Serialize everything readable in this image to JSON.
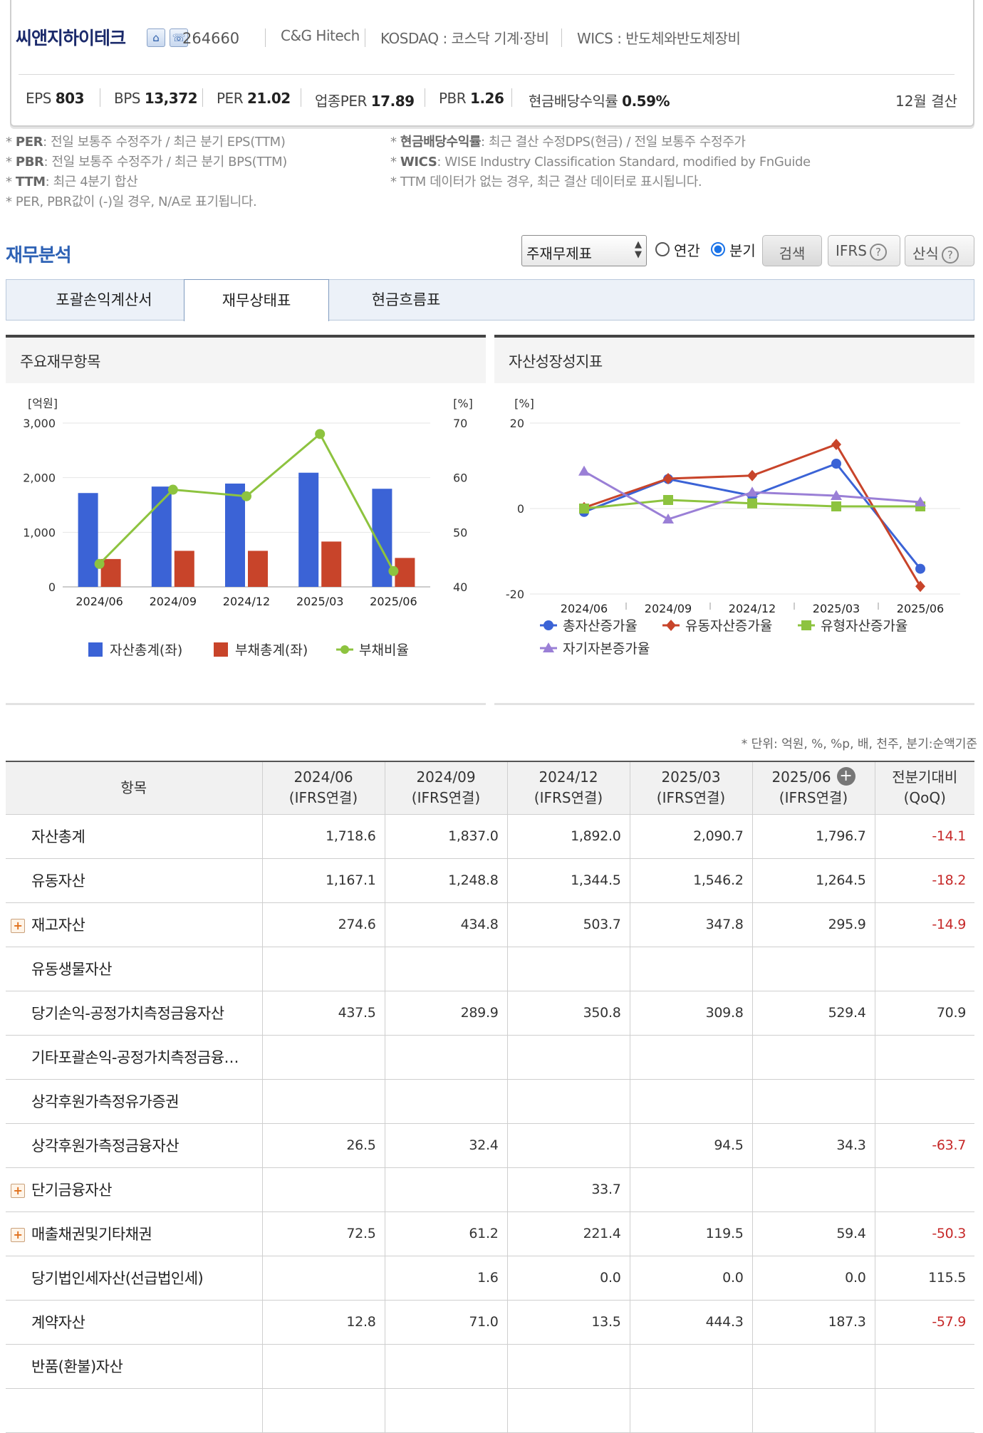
{
  "company": {
    "name": "씨앤지하이테크",
    "code": "264660",
    "english_name": "C&G Hitech",
    "market": "KOSDAQ : 코스닥 기계·장비",
    "wics": "WICS : 반도체와반도체장비"
  },
  "metrics": [
    {
      "label": "EPS",
      "value": "803"
    },
    {
      "label": "BPS",
      "value": "13,372"
    },
    {
      "label": "PER",
      "value": "21.02"
    },
    {
      "label": "업종PER",
      "value": "17.89"
    },
    {
      "label": "PBR",
      "value": "1.26"
    },
    {
      "label": "현금배당수익률",
      "value": "0.59%"
    }
  ],
  "fiscal_label": "12월 결산",
  "notes_left": [
    {
      "key": "PER",
      "text": ": 전일 보통주 수정주가 / 최근 분기 EPS(TTM)"
    },
    {
      "key": "PBR",
      "text": ": 전일 보통주 수정주가 / 최근 분기 BPS(TTM)"
    },
    {
      "key": "TTM",
      "text": ": 최근 4분기 합산"
    },
    {
      "key": "",
      "text": "PER, PBR값이 (-)일 경우, N/A로 표기됩니다."
    }
  ],
  "notes_right": [
    {
      "key": "현금배당수익률",
      "text": ": 최근 결산 수정DPS(현금) / 전일 보통주 수정주가"
    },
    {
      "key": "WICS",
      "text": ": WISE Industry Classification Standard, modified by FnGuide"
    },
    {
      "key": "",
      "text": "TTM 데이터가 없는 경우, 최근 결산 데이터로 표시됩니다."
    }
  ],
  "section_title": "재무분석",
  "controls": {
    "select_value": "주재무제표",
    "radio_annual": "연간",
    "radio_quarter": "분기",
    "search_btn": "검색",
    "ifrs_btn": "IFRS",
    "formula_btn": "산식",
    "help_glyph": "?"
  },
  "tabs": [
    "포괄손익계산서",
    "재무상태표",
    "현금흐름표"
  ],
  "panel_left_title": "주요재무항목",
  "panel_right_title": "자산성장성지표",
  "chart_data": [
    {
      "type": "bar",
      "categories": [
        "2024/06",
        "2024/09",
        "2024/12",
        "2025/03",
        "2025/06"
      ],
      "series": [
        {
          "name": "자산총계(좌)",
          "type": "bar",
          "axis": "left",
          "color": "#3b63d6",
          "values": [
            1718.6,
            1837.0,
            1892.0,
            2090.7,
            1796.7
          ]
        },
        {
          "name": "부채총계(좌)",
          "type": "bar",
          "axis": "left",
          "color": "#c8442a",
          "values": [
            510,
            660,
            660,
            830,
            530
          ]
        },
        {
          "name": "부채비율",
          "type": "line",
          "axis": "right",
          "color": "#8dc33f",
          "values": [
            44.2,
            57.8,
            56.6,
            68.0,
            42.9
          ]
        }
      ],
      "ylabel_left": "[억원]",
      "ylabel_right": "[%]",
      "ylim_left": [
        0,
        3000
      ],
      "ylim_right": [
        40,
        70
      ],
      "yticks_left": [
        "0",
        "1,000",
        "2,000",
        "3,000"
      ],
      "yticks_right": [
        "40",
        "50",
        "60",
        "70"
      ],
      "legend_position": "bottom"
    },
    {
      "type": "line",
      "categories": [
        "2024/06",
        "2024/09",
        "2024/12",
        "2025/03",
        "2025/06"
      ],
      "series": [
        {
          "name": "총자산증가율",
          "color": "#3b63d6",
          "marker": "circle",
          "values": [
            -0.8,
            6.9,
            3.0,
            10.5,
            -14.1
          ]
        },
        {
          "name": "유동자산증가율",
          "color": "#c8442a",
          "marker": "diamond",
          "values": [
            0.2,
            7.0,
            7.7,
            15.0,
            -18.2
          ]
        },
        {
          "name": "유형자산증가율",
          "color": "#8dc33f",
          "marker": "square",
          "values": [
            0.0,
            2.0,
            1.2,
            0.5,
            0.5
          ]
        },
        {
          "name": "자기자본증가율",
          "color": "#9a7fd6",
          "marker": "triangle",
          "values": [
            8.7,
            -2.5,
            3.8,
            3.0,
            1.5
          ]
        }
      ],
      "ylabel": "[%]",
      "ylim": [
        -20,
        20
      ],
      "yticks": [
        "-20",
        "0",
        "20"
      ],
      "legend_position": "bottom"
    }
  ],
  "units_note": "* 단위: 억원, %, %p, 배, 천주, 분기:순액기준",
  "table": {
    "header_item": "항목",
    "periods": [
      {
        "date": "2024/06",
        "basis": "(IFRS연결)"
      },
      {
        "date": "2024/09",
        "basis": "(IFRS연결)"
      },
      {
        "date": "2024/12",
        "basis": "(IFRS연결)"
      },
      {
        "date": "2025/03",
        "basis": "(IFRS연결)"
      },
      {
        "date": "2025/06",
        "basis": "(IFRS연결)"
      }
    ],
    "compare_header": [
      "전분기대비",
      "(QoQ)"
    ],
    "add_glyph": "+",
    "rows": [
      {
        "label": "자산총계",
        "expand": false,
        "values": [
          "1,718.6",
          "1,837.0",
          "1,892.0",
          "2,090.7",
          "1,796.7"
        ],
        "qoq": "-14.1",
        "neg": true
      },
      {
        "label": "유동자산",
        "expand": false,
        "values": [
          "1,167.1",
          "1,248.8",
          "1,344.5",
          "1,546.2",
          "1,264.5"
        ],
        "qoq": "-18.2",
        "neg": true
      },
      {
        "label": "재고자산",
        "expand": true,
        "values": [
          "274.6",
          "434.8",
          "503.7",
          "347.8",
          "295.9"
        ],
        "qoq": "-14.9",
        "neg": true
      },
      {
        "label": "유동생물자산",
        "expand": false,
        "values": [
          "",
          "",
          "",
          "",
          ""
        ],
        "qoq": "",
        "neg": false
      },
      {
        "label": "당기손익-공정가치측정금융자산",
        "expand": false,
        "values": [
          "437.5",
          "289.9",
          "350.8",
          "309.8",
          "529.4"
        ],
        "qoq": "70.9",
        "neg": false
      },
      {
        "label": "기타포괄손익-공정가치측정금융…",
        "expand": false,
        "values": [
          "",
          "",
          "",
          "",
          ""
        ],
        "qoq": "",
        "neg": false
      },
      {
        "label": "상각후원가측정유가증권",
        "expand": false,
        "values": [
          "",
          "",
          "",
          "",
          ""
        ],
        "qoq": "",
        "neg": false
      },
      {
        "label": "상각후원가측정금융자산",
        "expand": false,
        "values": [
          "26.5",
          "32.4",
          "",
          "94.5",
          "34.3"
        ],
        "qoq": "-63.7",
        "neg": true
      },
      {
        "label": "단기금융자산",
        "expand": true,
        "values": [
          "",
          "",
          "33.7",
          "",
          ""
        ],
        "qoq": "",
        "neg": false
      },
      {
        "label": "매출채권및기타채권",
        "expand": true,
        "values": [
          "72.5",
          "61.2",
          "221.4",
          "119.5",
          "59.4"
        ],
        "qoq": "-50.3",
        "neg": true
      },
      {
        "label": "당기법인세자산(선급법인세)",
        "expand": false,
        "values": [
          "",
          "1.6",
          "0.0",
          "0.0",
          "0.0"
        ],
        "qoq": "115.5",
        "neg": false
      },
      {
        "label": "계약자산",
        "expand": false,
        "values": [
          "12.8",
          "71.0",
          "13.5",
          "444.3",
          "187.3"
        ],
        "qoq": "-57.9",
        "neg": true
      },
      {
        "label": "반품(환불)자산",
        "expand": false,
        "values": [
          "",
          "",
          "",
          "",
          ""
        ],
        "qoq": "",
        "neg": false
      },
      {
        "label": "",
        "expand": false,
        "values": [
          "",
          "",
          "",
          "",
          ""
        ],
        "qoq": "",
        "neg": false
      }
    ]
  }
}
